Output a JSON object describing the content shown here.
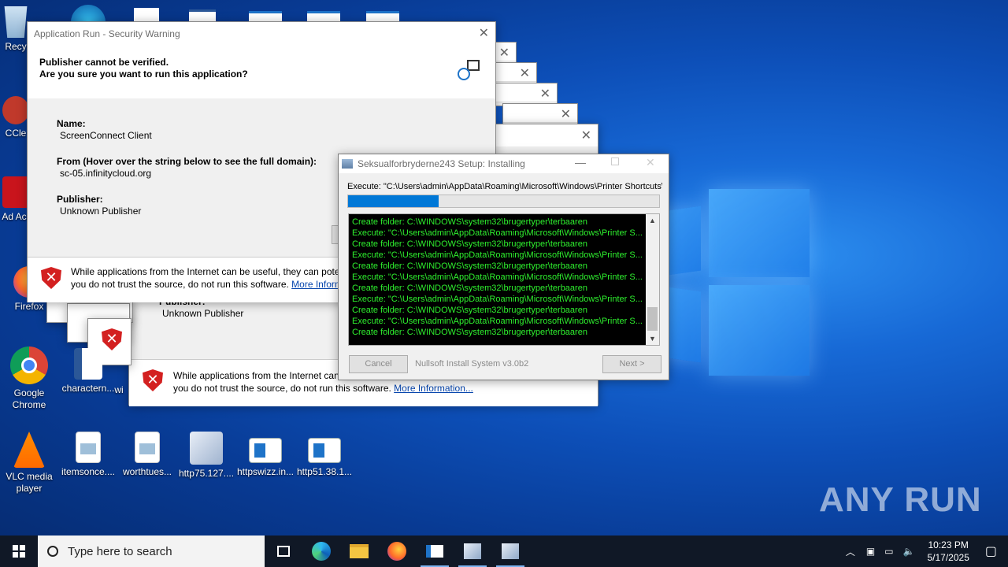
{
  "desktop": {
    "icons_left": [
      {
        "label": "Recy",
        "kind": "recycle"
      },
      {
        "label": "CCle",
        "kind": "ccleaner"
      },
      {
        "label": "Ad Acr",
        "kind": "acrobat"
      },
      {
        "label": "Firefox",
        "kind": "firefox"
      },
      {
        "label": "Google Chrome",
        "kind": "chrome"
      },
      {
        "label": "VLC media player",
        "kind": "vlc"
      }
    ],
    "icons_row": [
      {
        "label": "itemsonce....",
        "kind": "doc"
      },
      {
        "label": "worthtues...",
        "kind": "doc"
      },
      {
        "label": "http75.127....",
        "kind": "mail"
      },
      {
        "label": "httpswizz.in...",
        "kind": "win"
      },
      {
        "label": "http51.38.1...",
        "kind": "win"
      }
    ],
    "word_icon_label": "charactern...",
    "partial_label": "wi"
  },
  "security_dialog": {
    "title": "Application Run - Security Warning",
    "heading1": "Publisher cannot be verified.",
    "heading2": "Are you sure you want to run this application?",
    "name_label": "Name:",
    "name_value": "ScreenConnect Client",
    "from_label": "From (Hover over the string below to see the full domain):",
    "from_value": "sc-05.infinitycloud.org",
    "publisher_label": "Publisher:",
    "publisher_value": "Unknown Publisher",
    "warning_line1": "While applications from the Internet can be useful, they can pote",
    "warning_line2": "you do not trust the source, do not run this software.",
    "more_info": "More Inforn"
  },
  "back_dialog": {
    "publisher_label": "Publisher:",
    "publisher_value": "Unknown Publisher",
    "warning_line1": "While applications from the Internet can",
    "warning_line2": "you do not trust the source, do not run this software.",
    "more_info": "More Information..."
  },
  "nsis": {
    "title": "Seksualforbryderne243 Setup: Installing",
    "execute": "Execute: \"C:\\Users\\admin\\AppData\\Roaming\\Microsoft\\Windows\\Printer Shortcuts\\",
    "progress": 0.29,
    "log": [
      "Create folder: C:\\WINDOWS\\system32\\brugertyper\\terbaaren",
      "Execute: \"C:\\Users\\admin\\AppData\\Roaming\\Microsoft\\Windows\\Printer S...",
      "Create folder: C:\\WINDOWS\\system32\\brugertyper\\terbaaren",
      "Execute: \"C:\\Users\\admin\\AppData\\Roaming\\Microsoft\\Windows\\Printer S...",
      "Create folder: C:\\WINDOWS\\system32\\brugertyper\\terbaaren",
      "Execute: \"C:\\Users\\admin\\AppData\\Roaming\\Microsoft\\Windows\\Printer S...",
      "Create folder: C:\\WINDOWS\\system32\\brugertyper\\terbaaren",
      "Execute: \"C:\\Users\\admin\\AppData\\Roaming\\Microsoft\\Windows\\Printer S...",
      "Create folder: C:\\WINDOWS\\system32\\brugertyper\\terbaaren",
      "Execute: \"C:\\Users\\admin\\AppData\\Roaming\\Microsoft\\Windows\\Printer S...",
      "Create folder: C:\\WINDOWS\\system32\\brugertyper\\terbaaren"
    ],
    "cancel": "Cancel",
    "brand": "Nullsoft Install System v3.0b2",
    "next": "Next >"
  },
  "taskbar": {
    "search_placeholder": "Type here to search",
    "time": "10:23 PM",
    "date": "5/17/2025"
  },
  "watermark": "ANY RUN",
  "colors": {
    "accent": "#0078d7",
    "log_text": "#2ef02e",
    "shield": "#d32020"
  }
}
